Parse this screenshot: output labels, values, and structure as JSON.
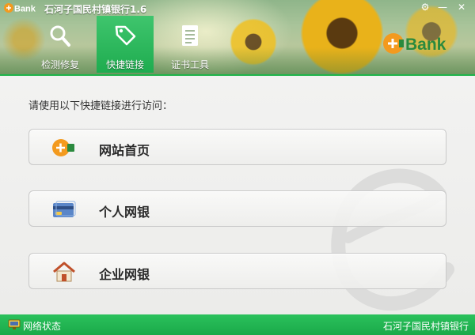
{
  "window": {
    "title": "石河子国民村镇银行1.6",
    "logo_text": "Bank",
    "controls": {
      "settings_glyph": "⚙",
      "minimize_glyph": "—",
      "close_glyph": "✕"
    }
  },
  "tabs": [
    {
      "label": "检测修复",
      "icon": "magnifier-icon",
      "active": false
    },
    {
      "label": "快捷链接",
      "icon": "tag-icon",
      "active": true
    },
    {
      "label": "证书工具",
      "icon": "document-icon",
      "active": false
    }
  ],
  "main": {
    "prompt": "请使用以下快捷链接进行访问：",
    "links": [
      {
        "label": "网站首页",
        "icon": "ebank-logo-icon"
      },
      {
        "label": "个人网银",
        "icon": "bank-card-icon"
      },
      {
        "label": "企业网银",
        "icon": "house-icon"
      }
    ]
  },
  "statusbar": {
    "network_label": "网络状态",
    "bank_name": "石河子国民村镇银行"
  },
  "colors": {
    "accent_green": "#1fb44a",
    "logo_orange": "#f39a1e",
    "logo_green": "#2b8a3e"
  }
}
